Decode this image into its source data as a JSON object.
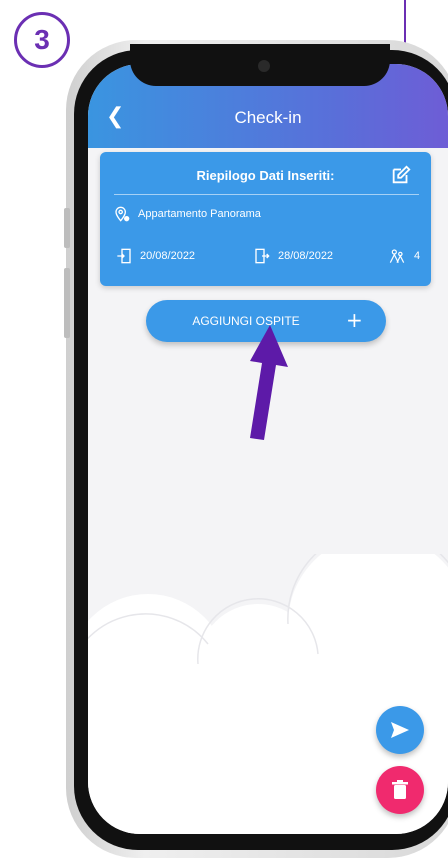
{
  "tutorial": {
    "step_number": "3"
  },
  "header": {
    "back_icon": "chevron-left-icon",
    "title": "Check-in"
  },
  "summary": {
    "title": "Riepilogo Dati Inseriti:",
    "edit_icon": "edit-icon",
    "property": "Appartamento Panorama",
    "checkin_date": "20/08/2022",
    "checkout_date": "28/08/2022",
    "guests": "4"
  },
  "add_guests": {
    "label": "AGGIUNGI OSPITE",
    "icon": "+"
  },
  "fabs": {
    "send_icon": "send-icon",
    "delete_icon": "trash-icon"
  },
  "colors": {
    "accent_purple": "#6b2fb3",
    "primary_blue": "#3b99e8",
    "delete_pink": "#f02a6e"
  }
}
